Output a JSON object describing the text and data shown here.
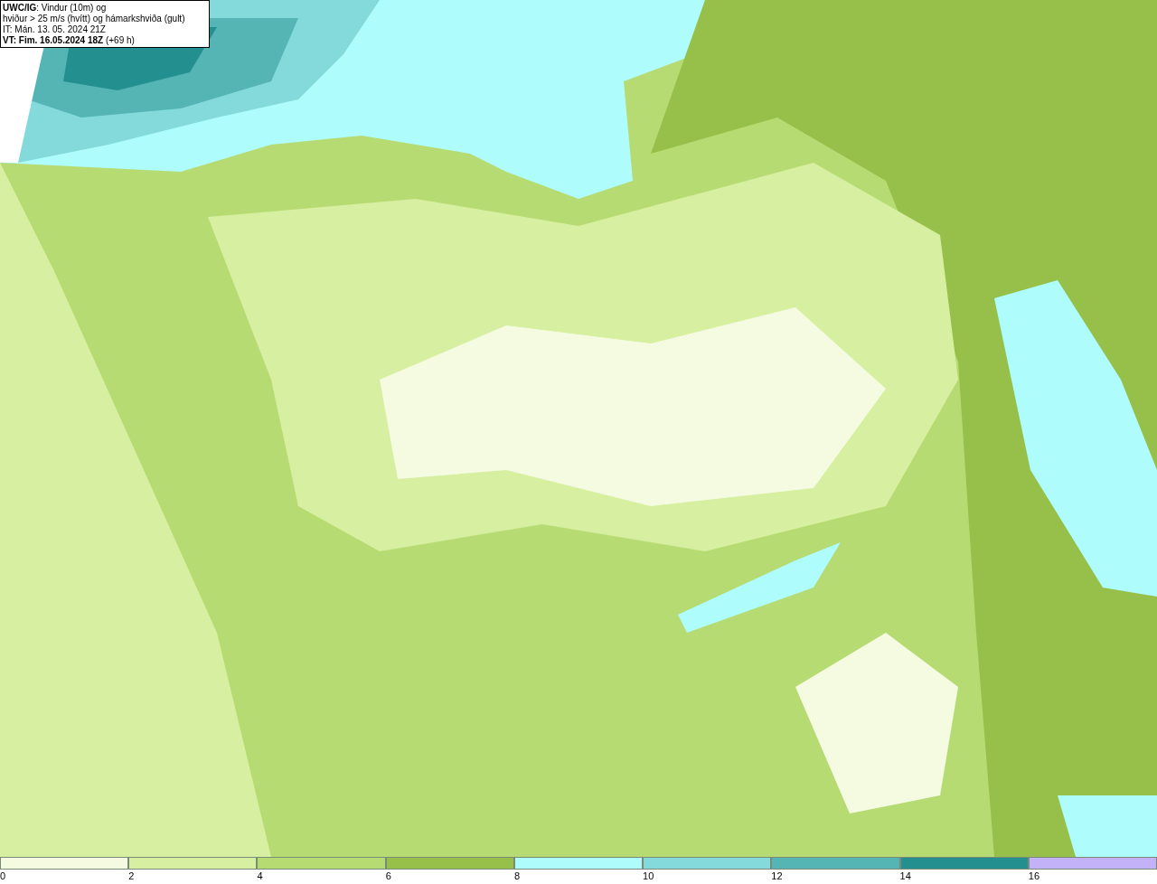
{
  "title_box": {
    "lines": [
      "**UWC/IG**: Vindur (10m) og",
      "hviður > 25 m/s (hvítt) og hámarkshviða (gult)",
      "IT: Mán. 13. 05. 2024 21Z",
      "**VT: Fim. 16.05.2024 18Z** (+69 h)"
    ]
  },
  "legend": {
    "segments": [
      {
        "color": "#f4fbe0",
        "label": "0"
      },
      {
        "color": "#d6efa0",
        "label": "2"
      },
      {
        "color": "#b7db73",
        "label": "4"
      },
      {
        "color": "#97c04a",
        "label": "6"
      },
      {
        "color": "#aefcfc",
        "label": "8"
      },
      {
        "color": "#84dada",
        "label": "10"
      },
      {
        "color": "#55b5b5",
        "label": "12"
      },
      {
        "color": "#248f8f",
        "label": "14"
      },
      {
        "color": "#c4b2f9",
        "label": "16"
      }
    ]
  }
}
